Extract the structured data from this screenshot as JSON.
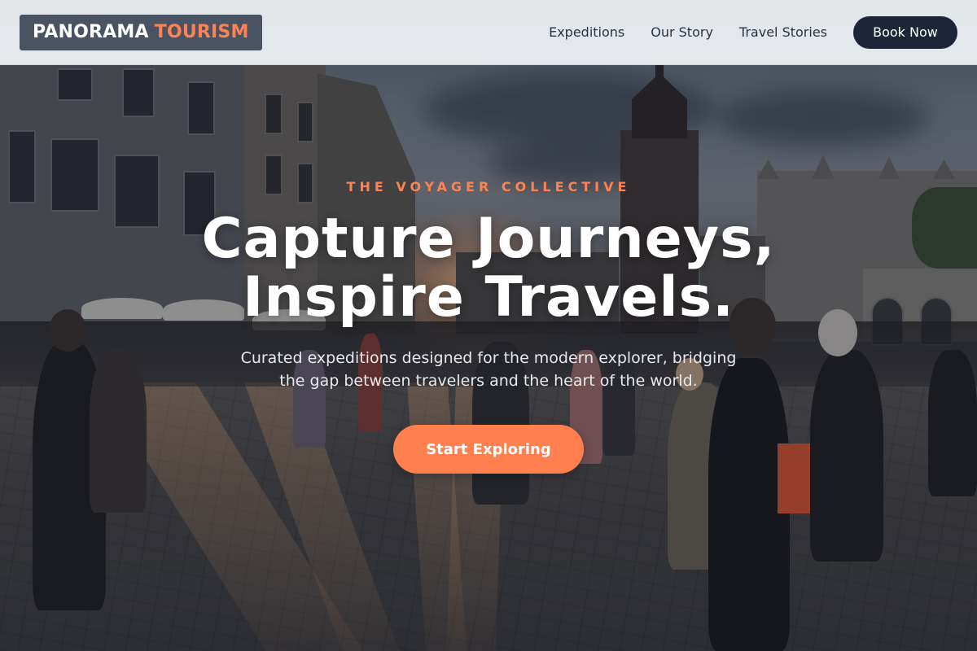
{
  "brand": {
    "name_part1": "PANORAMA",
    "name_part2": "TOURISM"
  },
  "nav": {
    "links": [
      "Expeditions",
      "Our Story",
      "Travel Stories"
    ],
    "cta": "Book Now"
  },
  "hero": {
    "eyebrow": "THE VOYAGER COLLECTIVE",
    "title_line1": "Capture Journeys,",
    "title_line2": "Inspire Travels.",
    "subtitle_line1": "Curated expeditions designed for the modern explorer, bridging",
    "subtitle_line2": "the gap between travelers and the heart of the world.",
    "cta": "Start Exploring",
    "background": "city-square-sunset-photo"
  },
  "colors": {
    "accent": "#ff7f4f",
    "header_bg": "#edeff2",
    "logo_bg": "#4a5362",
    "button_dark": "#1c2638"
  }
}
